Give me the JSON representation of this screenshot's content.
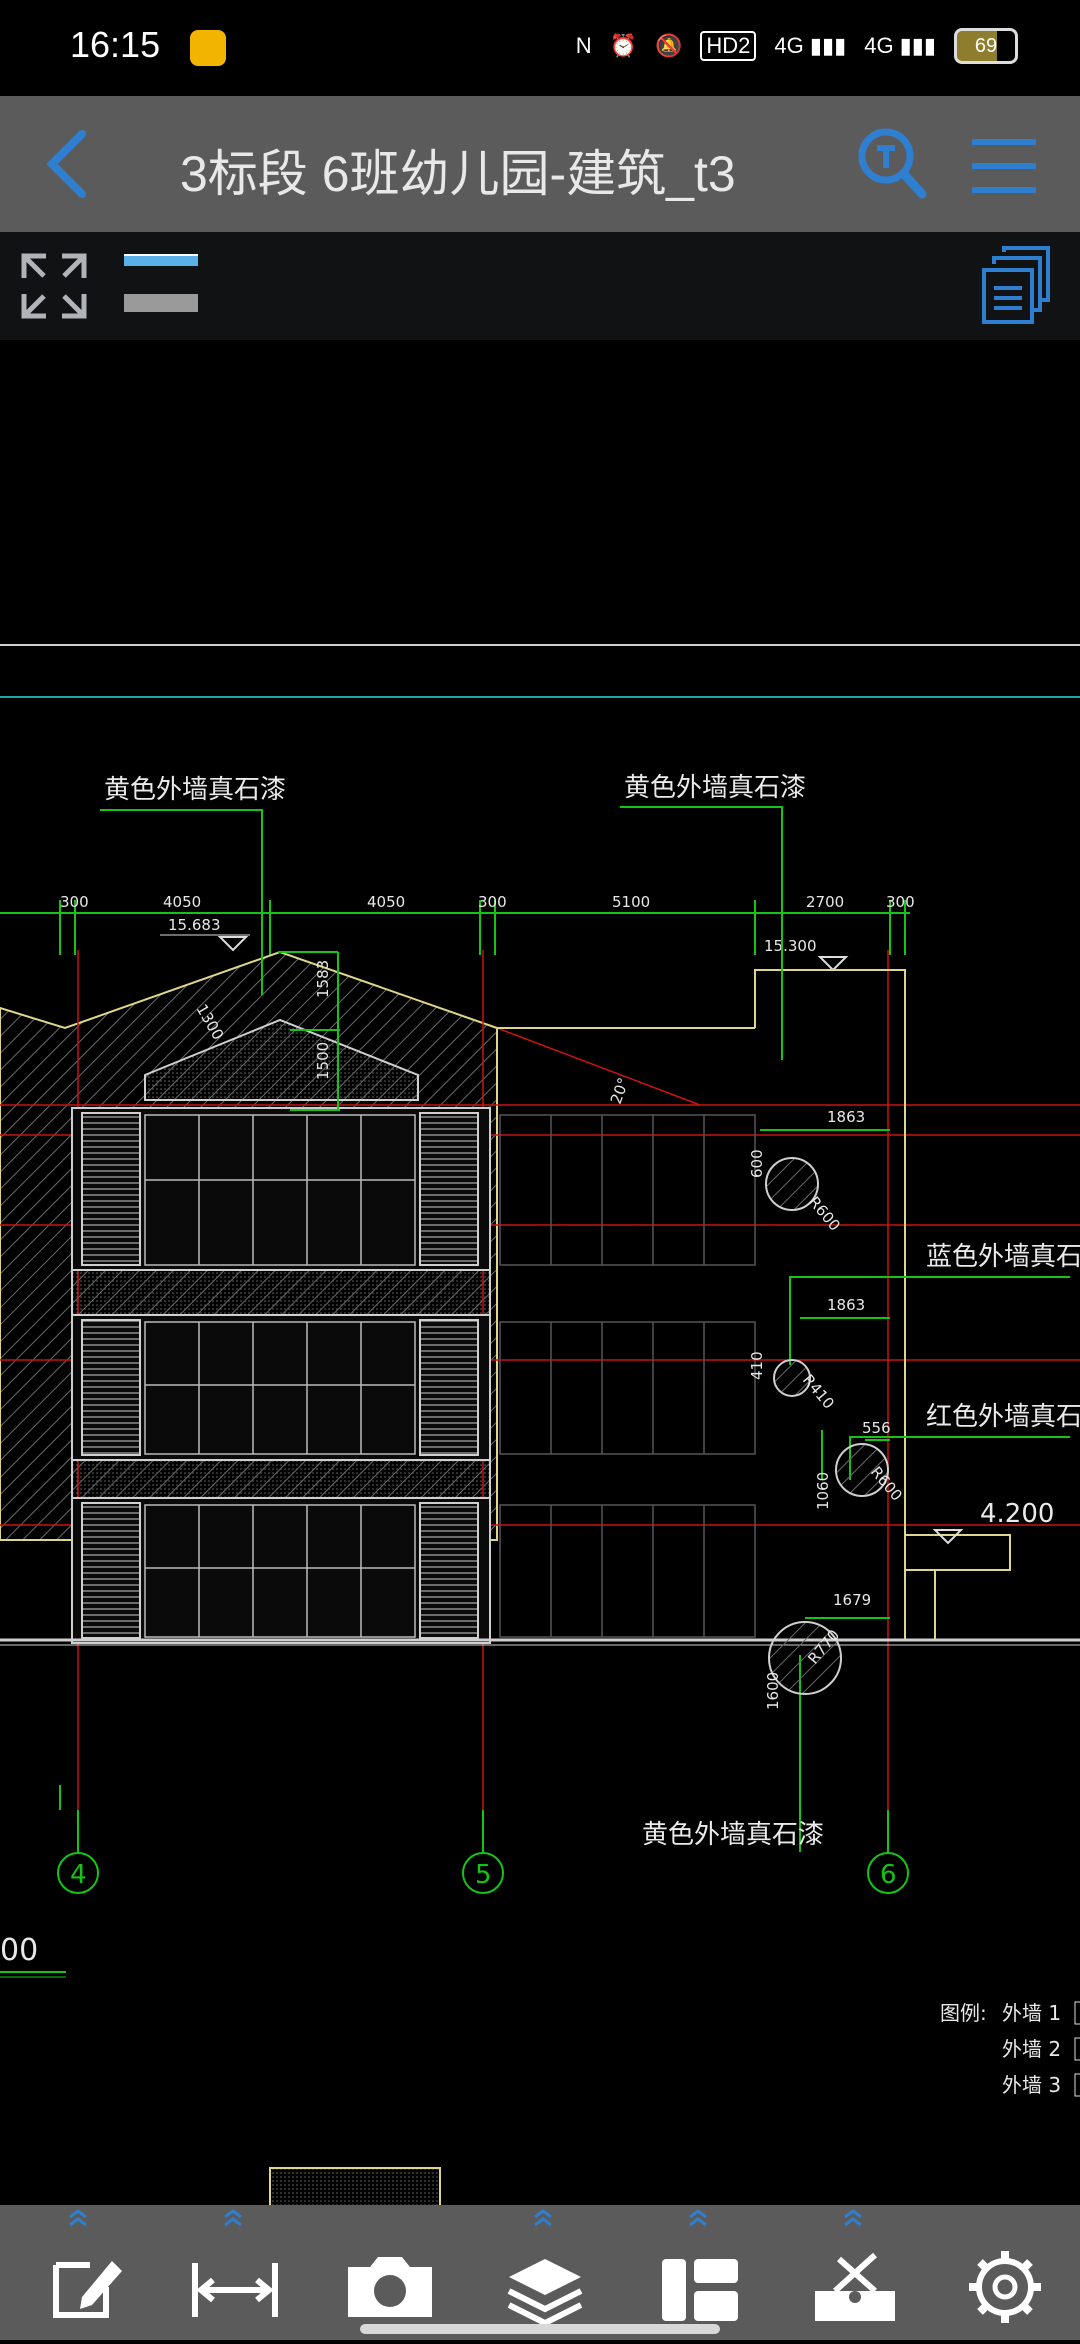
{
  "statusbar": {
    "time": "16:15",
    "icons": [
      "nfc-icon",
      "alarm-icon",
      "mute-icon",
      "hd-icon",
      "4g-signal-icon",
      "4g-signal-icon"
    ],
    "hd": "HD2",
    "network1": "4G",
    "network2": "4G",
    "battery": "69"
  },
  "header": {
    "title": "3标段 6班幼儿园-建筑_t3",
    "back_icon": "back-icon",
    "search_icon": "text-search-icon",
    "menu_icon": "menu-icon",
    "accent": "#2f7fd1"
  },
  "subtoolbar": {
    "expand_icon": "fullscreen-icon",
    "pages_icon": "layers-doc-icon"
  },
  "drawing": {
    "notes": {
      "yellow_left": "黄色外墙真石漆",
      "yellow_right": "黄色外墙真石漆",
      "blue": "蓝色外墙真石漆",
      "red": "红色外墙真石漆",
      "yellow_bottom": "黄色外墙真石漆"
    },
    "dimensions_top": [
      "300",
      "4050",
      "4050",
      "300",
      "5100",
      "2700",
      "300"
    ],
    "elevations": [
      "15.683",
      "15.300",
      "4.200"
    ],
    "dims_misc": [
      "1583",
      "1500",
      "1300",
      "20°",
      "1863",
      "600",
      "R600",
      "1863",
      "410",
      "R410",
      "556",
      "1060",
      "R600",
      "1679",
      "1600",
      "R770"
    ],
    "axis_labels": [
      "4",
      "5",
      "6"
    ],
    "partial_text": "00",
    "legend": {
      "label": "图例:",
      "items": [
        "外墙 1",
        "外墙 2",
        "外墙 3"
      ]
    }
  },
  "bottombar": {
    "items": [
      {
        "name": "edit-icon"
      },
      {
        "name": "measure-icon"
      },
      {
        "name": "camera-icon"
      },
      {
        "name": "layers-icon"
      },
      {
        "name": "layout-icon"
      },
      {
        "name": "tools-icon"
      },
      {
        "name": "settings-icon"
      }
    ]
  }
}
